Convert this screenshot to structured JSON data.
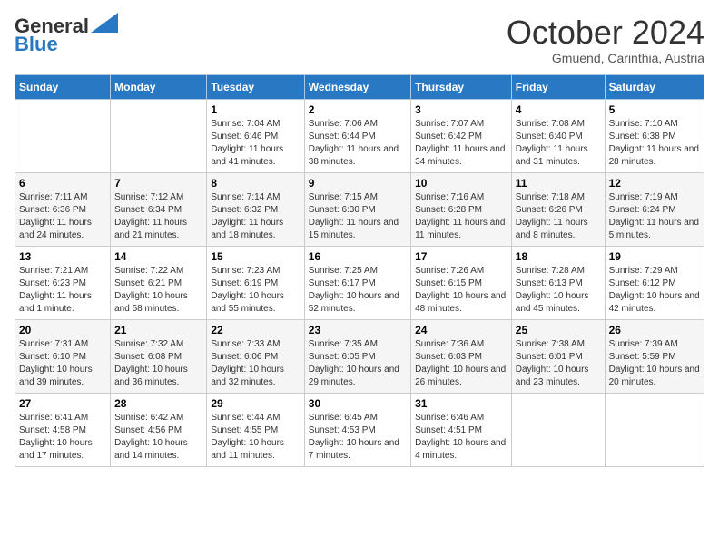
{
  "header": {
    "logo_general": "General",
    "logo_blue": "Blue",
    "month_title": "October 2024",
    "subtitle": "Gmuend, Carinthia, Austria"
  },
  "days_of_week": [
    "Sunday",
    "Monday",
    "Tuesday",
    "Wednesday",
    "Thursday",
    "Friday",
    "Saturday"
  ],
  "weeks": [
    [
      {
        "num": "",
        "info": ""
      },
      {
        "num": "",
        "info": ""
      },
      {
        "num": "1",
        "info": "Sunrise: 7:04 AM\nSunset: 6:46 PM\nDaylight: 11 hours and 41 minutes."
      },
      {
        "num": "2",
        "info": "Sunrise: 7:06 AM\nSunset: 6:44 PM\nDaylight: 11 hours and 38 minutes."
      },
      {
        "num": "3",
        "info": "Sunrise: 7:07 AM\nSunset: 6:42 PM\nDaylight: 11 hours and 34 minutes."
      },
      {
        "num": "4",
        "info": "Sunrise: 7:08 AM\nSunset: 6:40 PM\nDaylight: 11 hours and 31 minutes."
      },
      {
        "num": "5",
        "info": "Sunrise: 7:10 AM\nSunset: 6:38 PM\nDaylight: 11 hours and 28 minutes."
      }
    ],
    [
      {
        "num": "6",
        "info": "Sunrise: 7:11 AM\nSunset: 6:36 PM\nDaylight: 11 hours and 24 minutes."
      },
      {
        "num": "7",
        "info": "Sunrise: 7:12 AM\nSunset: 6:34 PM\nDaylight: 11 hours and 21 minutes."
      },
      {
        "num": "8",
        "info": "Sunrise: 7:14 AM\nSunset: 6:32 PM\nDaylight: 11 hours and 18 minutes."
      },
      {
        "num": "9",
        "info": "Sunrise: 7:15 AM\nSunset: 6:30 PM\nDaylight: 11 hours and 15 minutes."
      },
      {
        "num": "10",
        "info": "Sunrise: 7:16 AM\nSunset: 6:28 PM\nDaylight: 11 hours and 11 minutes."
      },
      {
        "num": "11",
        "info": "Sunrise: 7:18 AM\nSunset: 6:26 PM\nDaylight: 11 hours and 8 minutes."
      },
      {
        "num": "12",
        "info": "Sunrise: 7:19 AM\nSunset: 6:24 PM\nDaylight: 11 hours and 5 minutes."
      }
    ],
    [
      {
        "num": "13",
        "info": "Sunrise: 7:21 AM\nSunset: 6:23 PM\nDaylight: 11 hours and 1 minute."
      },
      {
        "num": "14",
        "info": "Sunrise: 7:22 AM\nSunset: 6:21 PM\nDaylight: 10 hours and 58 minutes."
      },
      {
        "num": "15",
        "info": "Sunrise: 7:23 AM\nSunset: 6:19 PM\nDaylight: 10 hours and 55 minutes."
      },
      {
        "num": "16",
        "info": "Sunrise: 7:25 AM\nSunset: 6:17 PM\nDaylight: 10 hours and 52 minutes."
      },
      {
        "num": "17",
        "info": "Sunrise: 7:26 AM\nSunset: 6:15 PM\nDaylight: 10 hours and 48 minutes."
      },
      {
        "num": "18",
        "info": "Sunrise: 7:28 AM\nSunset: 6:13 PM\nDaylight: 10 hours and 45 minutes."
      },
      {
        "num": "19",
        "info": "Sunrise: 7:29 AM\nSunset: 6:12 PM\nDaylight: 10 hours and 42 minutes."
      }
    ],
    [
      {
        "num": "20",
        "info": "Sunrise: 7:31 AM\nSunset: 6:10 PM\nDaylight: 10 hours and 39 minutes."
      },
      {
        "num": "21",
        "info": "Sunrise: 7:32 AM\nSunset: 6:08 PM\nDaylight: 10 hours and 36 minutes."
      },
      {
        "num": "22",
        "info": "Sunrise: 7:33 AM\nSunset: 6:06 PM\nDaylight: 10 hours and 32 minutes."
      },
      {
        "num": "23",
        "info": "Sunrise: 7:35 AM\nSunset: 6:05 PM\nDaylight: 10 hours and 29 minutes."
      },
      {
        "num": "24",
        "info": "Sunrise: 7:36 AM\nSunset: 6:03 PM\nDaylight: 10 hours and 26 minutes."
      },
      {
        "num": "25",
        "info": "Sunrise: 7:38 AM\nSunset: 6:01 PM\nDaylight: 10 hours and 23 minutes."
      },
      {
        "num": "26",
        "info": "Sunrise: 7:39 AM\nSunset: 5:59 PM\nDaylight: 10 hours and 20 minutes."
      }
    ],
    [
      {
        "num": "27",
        "info": "Sunrise: 6:41 AM\nSunset: 4:58 PM\nDaylight: 10 hours and 17 minutes."
      },
      {
        "num": "28",
        "info": "Sunrise: 6:42 AM\nSunset: 4:56 PM\nDaylight: 10 hours and 14 minutes."
      },
      {
        "num": "29",
        "info": "Sunrise: 6:44 AM\nSunset: 4:55 PM\nDaylight: 10 hours and 11 minutes."
      },
      {
        "num": "30",
        "info": "Sunrise: 6:45 AM\nSunset: 4:53 PM\nDaylight: 10 hours and 7 minutes."
      },
      {
        "num": "31",
        "info": "Sunrise: 6:46 AM\nSunset: 4:51 PM\nDaylight: 10 hours and 4 minutes."
      },
      {
        "num": "",
        "info": ""
      },
      {
        "num": "",
        "info": ""
      }
    ]
  ]
}
